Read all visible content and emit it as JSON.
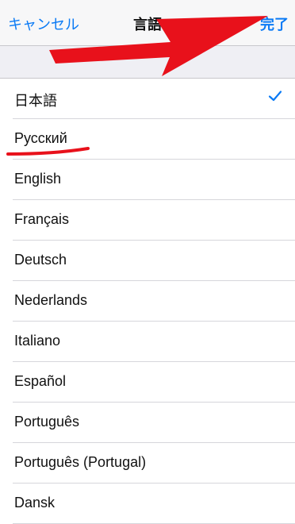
{
  "nav": {
    "cancel_label": "キャンセル",
    "title": "言語",
    "done_label": "完了"
  },
  "languages": [
    {
      "label": "日本語",
      "selected": true
    },
    {
      "label": "Русский",
      "selected": false
    },
    {
      "label": "English",
      "selected": false
    },
    {
      "label": "Français",
      "selected": false
    },
    {
      "label": "Deutsch",
      "selected": false
    },
    {
      "label": "Nederlands",
      "selected": false
    },
    {
      "label": "Italiano",
      "selected": false
    },
    {
      "label": "Español",
      "selected": false
    },
    {
      "label": "Português",
      "selected": false
    },
    {
      "label": "Português (Portugal)",
      "selected": false
    },
    {
      "label": "Dansk",
      "selected": false
    }
  ],
  "colors": {
    "accent": "#0a7af5",
    "annotation": "#e8111b"
  },
  "icons": {
    "selected": "checkmark-icon"
  }
}
